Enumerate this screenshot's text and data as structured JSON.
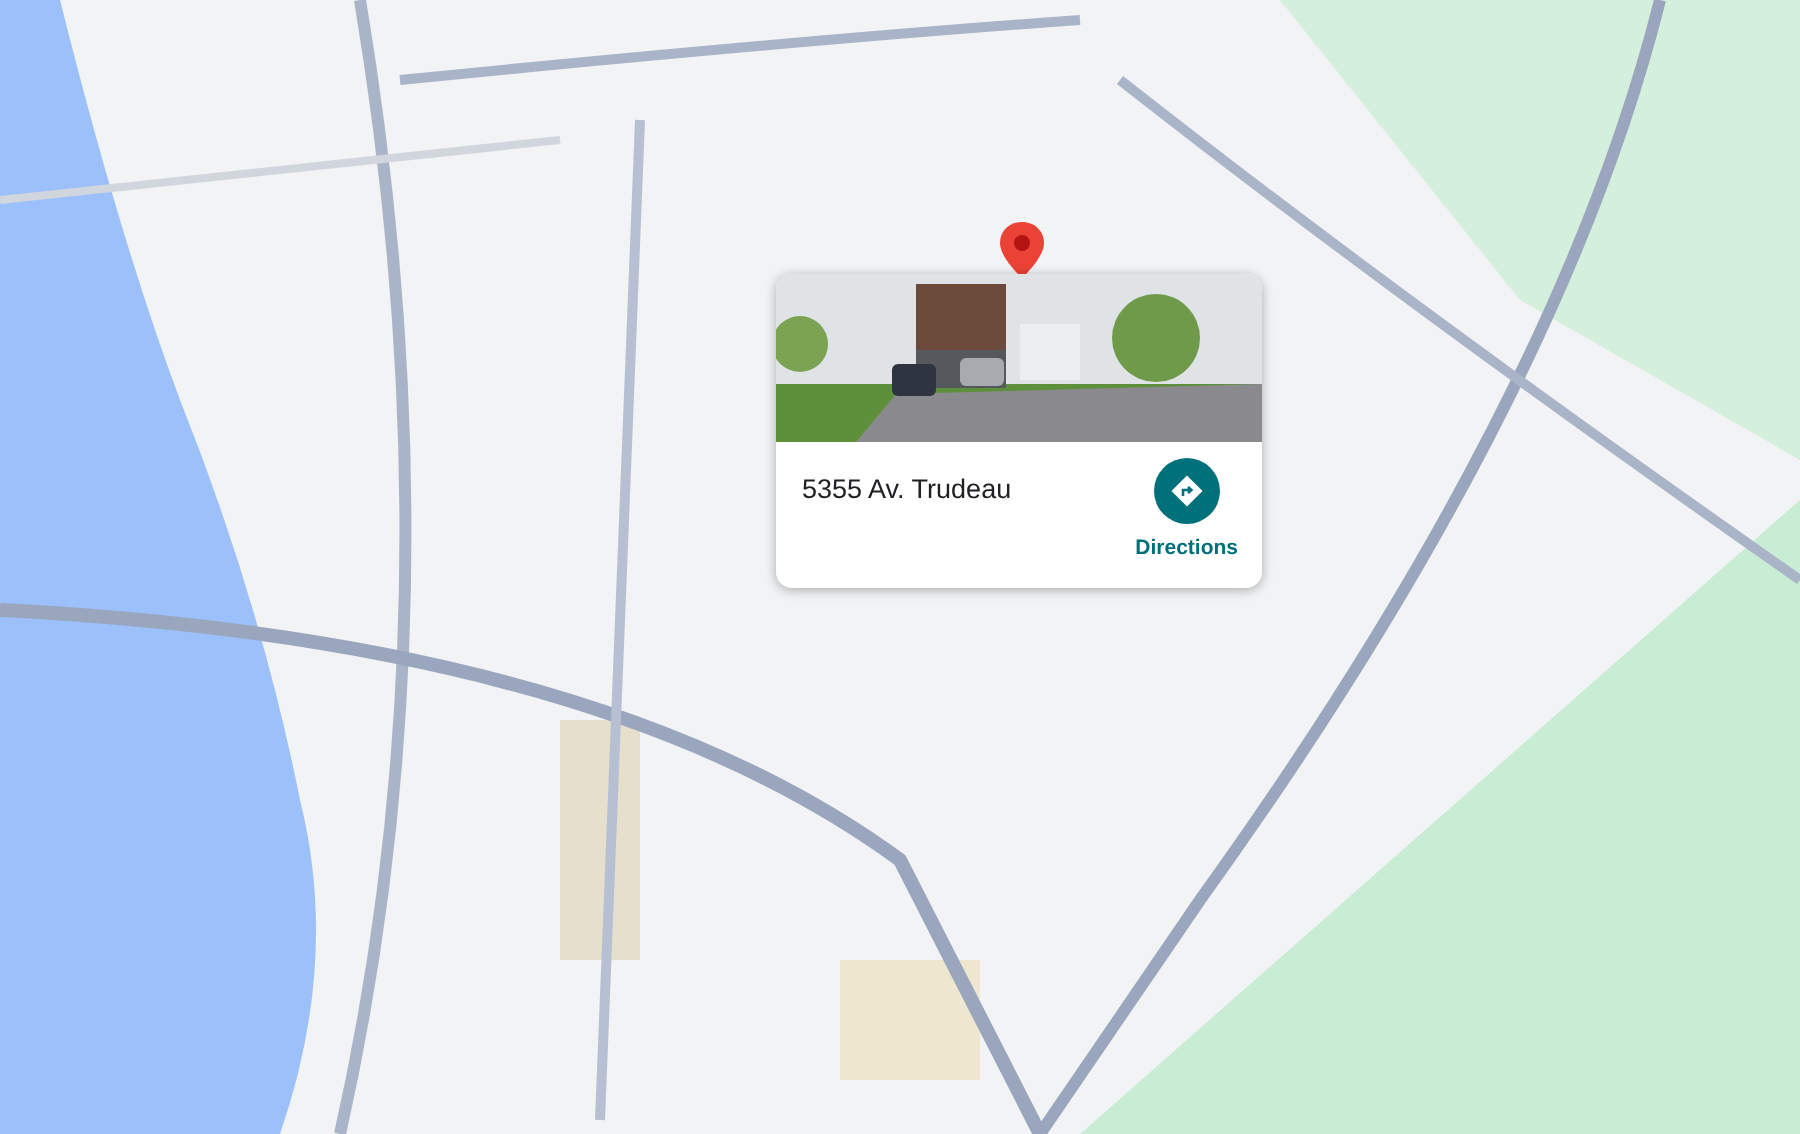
{
  "place_card": {
    "address": "5355 Av. Trudeau",
    "action": {
      "label": "Directions"
    }
  }
}
